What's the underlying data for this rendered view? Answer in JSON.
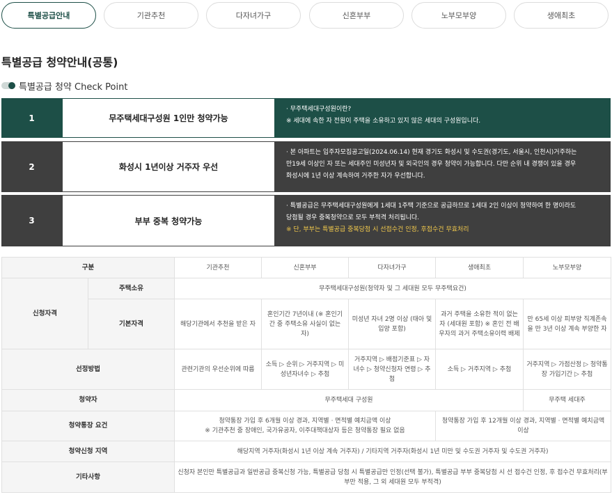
{
  "tabs": [
    {
      "label": "특별공급안내",
      "active": true
    },
    {
      "label": "기관추천"
    },
    {
      "label": "다자녀가구"
    },
    {
      "label": "신혼부부"
    },
    {
      "label": "노부모부양"
    },
    {
      "label": "생애최초"
    }
  ],
  "page_title": "특별공급 청약안내(공통)",
  "subtitle": "특별공급 청약 Check Point",
  "checkpoints": [
    {
      "num": "1",
      "head": "무주택세대구성원 1인만 청약가능",
      "lines": [
        "· 무주택세대구성원이란?",
        "※ 세대에 속한 자 전원이 주택을 소유하고 있지 않은 세대의 구성원입니다."
      ]
    },
    {
      "num": "2",
      "head": "화성시 1년이상 거주자 우선",
      "lines": [
        "· 본 아파트는 입주자모집공고일(2024.06.14) 현재 경기도 화성시 및 수도권(경기도, 서울시, 인천시)거주하는",
        "만19세 이상인 자 또는 세대주인 미성년자 및 외국인의 경우 청약이 가능합니다. 다만 순위 내 경쟁이 있을 경우",
        "화성시에 1년 이상 계속하여 거주한 자가 우선합니다."
      ]
    },
    {
      "num": "3",
      "head": "부부 중복 청약가능",
      "lines": [
        "· 특별공급은 무주택세대구성원에게 1세대 1주택 기준으로 공급하므로 1세대 2인 이상이 청약하여 한 명이라도",
        "당첨될 경우 중복청약으로 모두 부적격 처리됩니다."
      ],
      "note": "※ 단, 부부는 특별공급 중복당첨 시 선접수건 인정, 후접수건 무효처리"
    }
  ],
  "table": {
    "header": {
      "col": "구분",
      "types": [
        "기관추천",
        "신혼부부",
        "다자녀가구",
        "생애최초",
        "노부모부양"
      ]
    },
    "qual_label": "신청자격",
    "house_label": "주택소유",
    "house_value": "무주택세대구성원(청약자 및 그 세대원 모두 무주택요건)",
    "basic_label": "기본자격",
    "basic": [
      "해당기관에서 추천을 받은 자",
      "혼인기간 7년이내 (※ 혼인기간 중 주택소유 사실이 없는 자)",
      "미성년 자녀 2명 이상 (태아 및 입양 포함)",
      "과거 주택을 소유한 적이 없는 자 (세대원 포함) ※ 혼인 전 배우자의 과거 주택소유이력 배제",
      "만 65세 이상 피부양 직계존속을 만 3년 이상 계속 부양한 자"
    ],
    "select_label": "선정방법",
    "select": [
      "관련기관의 우선순위에 따름",
      "소득 ▷ 순위 ▷ 거주지역 ▷ 미성년자녀수 ▷ 추첨",
      "거주지역 ▷ 배점기준표 ▷ 자녀수 ▷ 청약신청자 연령 ▷ 추첨",
      "소득 ▷ 거주지역 ▷ 추첨",
      "거주지역 ▷ 가점산정 ▷ 청약통장 가입기간 ▷ 추첨"
    ],
    "applicant_label": "청약자",
    "applicant_a": "무주택세대 구성원",
    "applicant_b": "무주택 세대주",
    "account_label": "청약통장 요건",
    "account_a1": "청약통장 가입 후 6개월 이상 경과, 지역별 · 면적별 예치금액 이상",
    "account_a2": "※ 기관추천 중 장애인, 국가유공자, 이주대책대상자 등은 청약통장 필요 없음",
    "account_b": "청약통장 가입 후 12개월 이상 경과, 지역별 · 면적별 예치금액 이상",
    "region_label": "청약신청 지역",
    "region_value": "해당지역 거주자(화성시 1년 이상 계속 거주자) / 기타지역 거주자(화성시 1년 미만 및 수도권 거주자 및 수도권 거주자)",
    "etc_label": "기타사항",
    "etc_value": "신청자 본인만 특별공급과 일반공급 중복신청 가능, 특별공급 당첨 시 특별공급만 인정(선택 불가), 특별공급 부부 중복당첨 시 선 접수건 인정, 후 접수건 무효처리(부부만 적용, 그 외 세대원 모두 부적격)"
  }
}
